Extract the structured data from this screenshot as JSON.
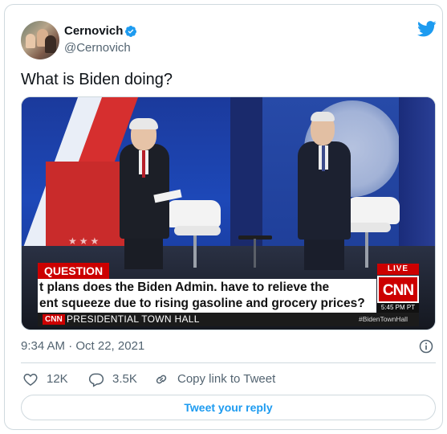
{
  "author": {
    "display_name": "Cernovich",
    "handle": "@Cernovich",
    "verified": true
  },
  "tweet": {
    "text": "What is Biden doing?",
    "timestamp": "9:34 AM · Oct 22, 2021"
  },
  "media": {
    "chyron": {
      "tag": "QUESTION",
      "line1": "t plans does the Biden Admin. have to relieve the",
      "line2": "ent squeeze due to rising gasoline and grocery prices?",
      "live": "LIVE",
      "network": "CNN",
      "time": "5:45 PM PT",
      "bottom_logo": "CNN",
      "bottom_title": "PRESIDENTIAL TOWN HALL",
      "hashtag": "#BidenTownHall"
    }
  },
  "actions": {
    "likes": "12K",
    "replies": "3.5K",
    "copy_link": "Copy link to Tweet"
  },
  "reply_button": "Tweet your reply",
  "colors": {
    "accent": "#1d9bf0",
    "text_secondary": "#536471",
    "border": "#cfd9de",
    "cnn_red": "#cc0000"
  },
  "icons": [
    "verified-badge-icon",
    "twitter-bird-icon",
    "info-icon",
    "heart-icon",
    "reply-bubble-icon",
    "link-icon"
  ]
}
